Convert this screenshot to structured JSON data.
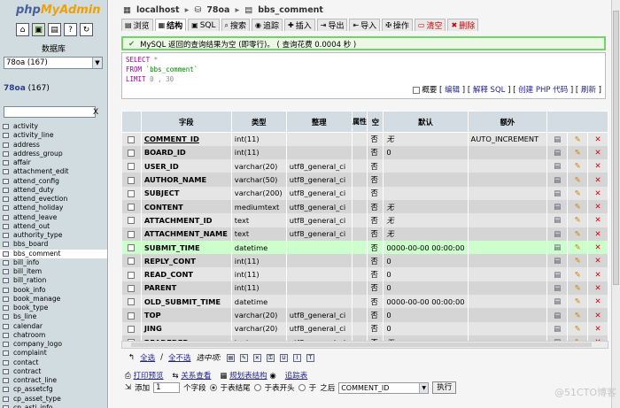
{
  "left": {
    "logo_php": "php",
    "logo_myadmin": "MyAdmin",
    "database_label": "数据库",
    "database_select": "78oa (167)",
    "db_title_name": "78oa",
    "db_title_count": "(167)",
    "filter_clear": "X",
    "tables": [
      "activity",
      "activity_line",
      "address",
      "address_group",
      "affair",
      "attachment_edit",
      "attend_config",
      "attend_duty",
      "attend_evection",
      "attend_holiday",
      "attend_leave",
      "attend_out",
      "authority_type",
      "bbs_board",
      "bbs_comment",
      "bill_info",
      "bill_item",
      "bill_ration",
      "book_info",
      "book_manage",
      "book_type",
      "bs_line",
      "calendar",
      "chatroom",
      "company_logo",
      "complaint",
      "contact",
      "contract",
      "contract_line",
      "cp_assetcfg",
      "cp_asset_type",
      "cp_asti_info"
    ],
    "selected_table": "bbs_comment"
  },
  "breadcrumb": {
    "server": "localhost",
    "database": "78oa",
    "table": "bbs_comment"
  },
  "tabs": [
    "浏览",
    "结构",
    "SQL",
    "搜索",
    "追踪",
    "插入",
    "导出",
    "导入",
    "操作",
    "清空",
    "删除"
  ],
  "notice": {
    "icon": "✔",
    "text": "MySQL 返回的查询结果为空 (即零行)。 ( 查询花费 0.0004 秒 )"
  },
  "sql": {
    "line1_kw": "SELECT",
    "line1_rest": " *",
    "line2_kw": "FROM",
    "line2_rest": " `bbs_comment`",
    "line3_kw": "LIMIT",
    "line3_rest": " 0 , 30",
    "profile_label": "概要",
    "links": [
      "编辑",
      "解释 SQL",
      "创建 PHP 代码",
      "刷新"
    ]
  },
  "table": {
    "headers": [
      "字段",
      "类型",
      "整理",
      "属性",
      "空",
      "默认",
      "额外"
    ],
    "rows": [
      {
        "field": "COMMENT_ID",
        "pk": true,
        "type": "int(11)",
        "collation": "",
        "null": "否",
        "default": "无",
        "extra": "AUTO_INCREMENT"
      },
      {
        "field": "BOARD_ID",
        "type": "int(11)",
        "collation": "",
        "null": "否",
        "default": "0",
        "extra": ""
      },
      {
        "field": "USER_ID",
        "type": "varchar(20)",
        "collation": "utf8_general_ci",
        "null": "否",
        "default": "",
        "extra": ""
      },
      {
        "field": "AUTHOR_NAME",
        "type": "varchar(50)",
        "collation": "utf8_general_ci",
        "null": "否",
        "default": "",
        "extra": ""
      },
      {
        "field": "SUBJECT",
        "type": "varchar(200)",
        "collation": "utf8_general_ci",
        "null": "否",
        "default": "",
        "extra": ""
      },
      {
        "field": "CONTENT",
        "type": "mediumtext",
        "collation": "utf8_general_ci",
        "null": "否",
        "default": "无",
        "extra": ""
      },
      {
        "field": "ATTACHMENT_ID",
        "type": "text",
        "collation": "utf8_general_ci",
        "null": "否",
        "default": "无",
        "extra": ""
      },
      {
        "field": "ATTACHMENT_NAME",
        "type": "text",
        "collation": "utf8_general_ci",
        "null": "否",
        "default": "无",
        "extra": ""
      },
      {
        "field": "SUBMIT_TIME",
        "type": "datetime",
        "collation": "",
        "null": "否",
        "default": "0000-00-00 00:00:00",
        "extra": "",
        "highlight": true
      },
      {
        "field": "REPLY_CONT",
        "type": "int(11)",
        "collation": "",
        "null": "否",
        "default": "0",
        "extra": ""
      },
      {
        "field": "READ_CONT",
        "type": "int(11)",
        "collation": "",
        "null": "否",
        "default": "0",
        "extra": ""
      },
      {
        "field": "PARENT",
        "type": "int(11)",
        "collation": "",
        "null": "否",
        "default": "0",
        "extra": ""
      },
      {
        "field": "OLD_SUBMIT_TIME",
        "type": "datetime",
        "collation": "",
        "null": "否",
        "default": "0000-00-00 00:00:00",
        "extra": ""
      },
      {
        "field": "TOP",
        "type": "varchar(20)",
        "collation": "utf8_general_ci",
        "null": "否",
        "default": "0",
        "extra": ""
      },
      {
        "field": "JING",
        "type": "varchar(20)",
        "collation": "utf8_general_ci",
        "null": "否",
        "default": "0",
        "extra": ""
      },
      {
        "field": "READEDER",
        "type": "text",
        "collation": "utf8_general_ci",
        "null": "否",
        "default": "无",
        "extra": ""
      }
    ]
  },
  "bottom": {
    "select_all": "全选",
    "deselect_all": "全不选",
    "with_selected": "选中项:",
    "print_view": "打印预览",
    "relation_view": "关系查看",
    "propose_structure": "规划表结构",
    "track_table": "追踪表",
    "add_label": "添加",
    "add_count": "1",
    "field_label": "个字段",
    "at_end": "于表结尾",
    "at_beginning": "于表开头",
    "after": "于",
    "after_suffix": "之后",
    "after_field": "COMMENT_ID",
    "go_button": "执行"
  },
  "watermark": "@51CTO博客"
}
